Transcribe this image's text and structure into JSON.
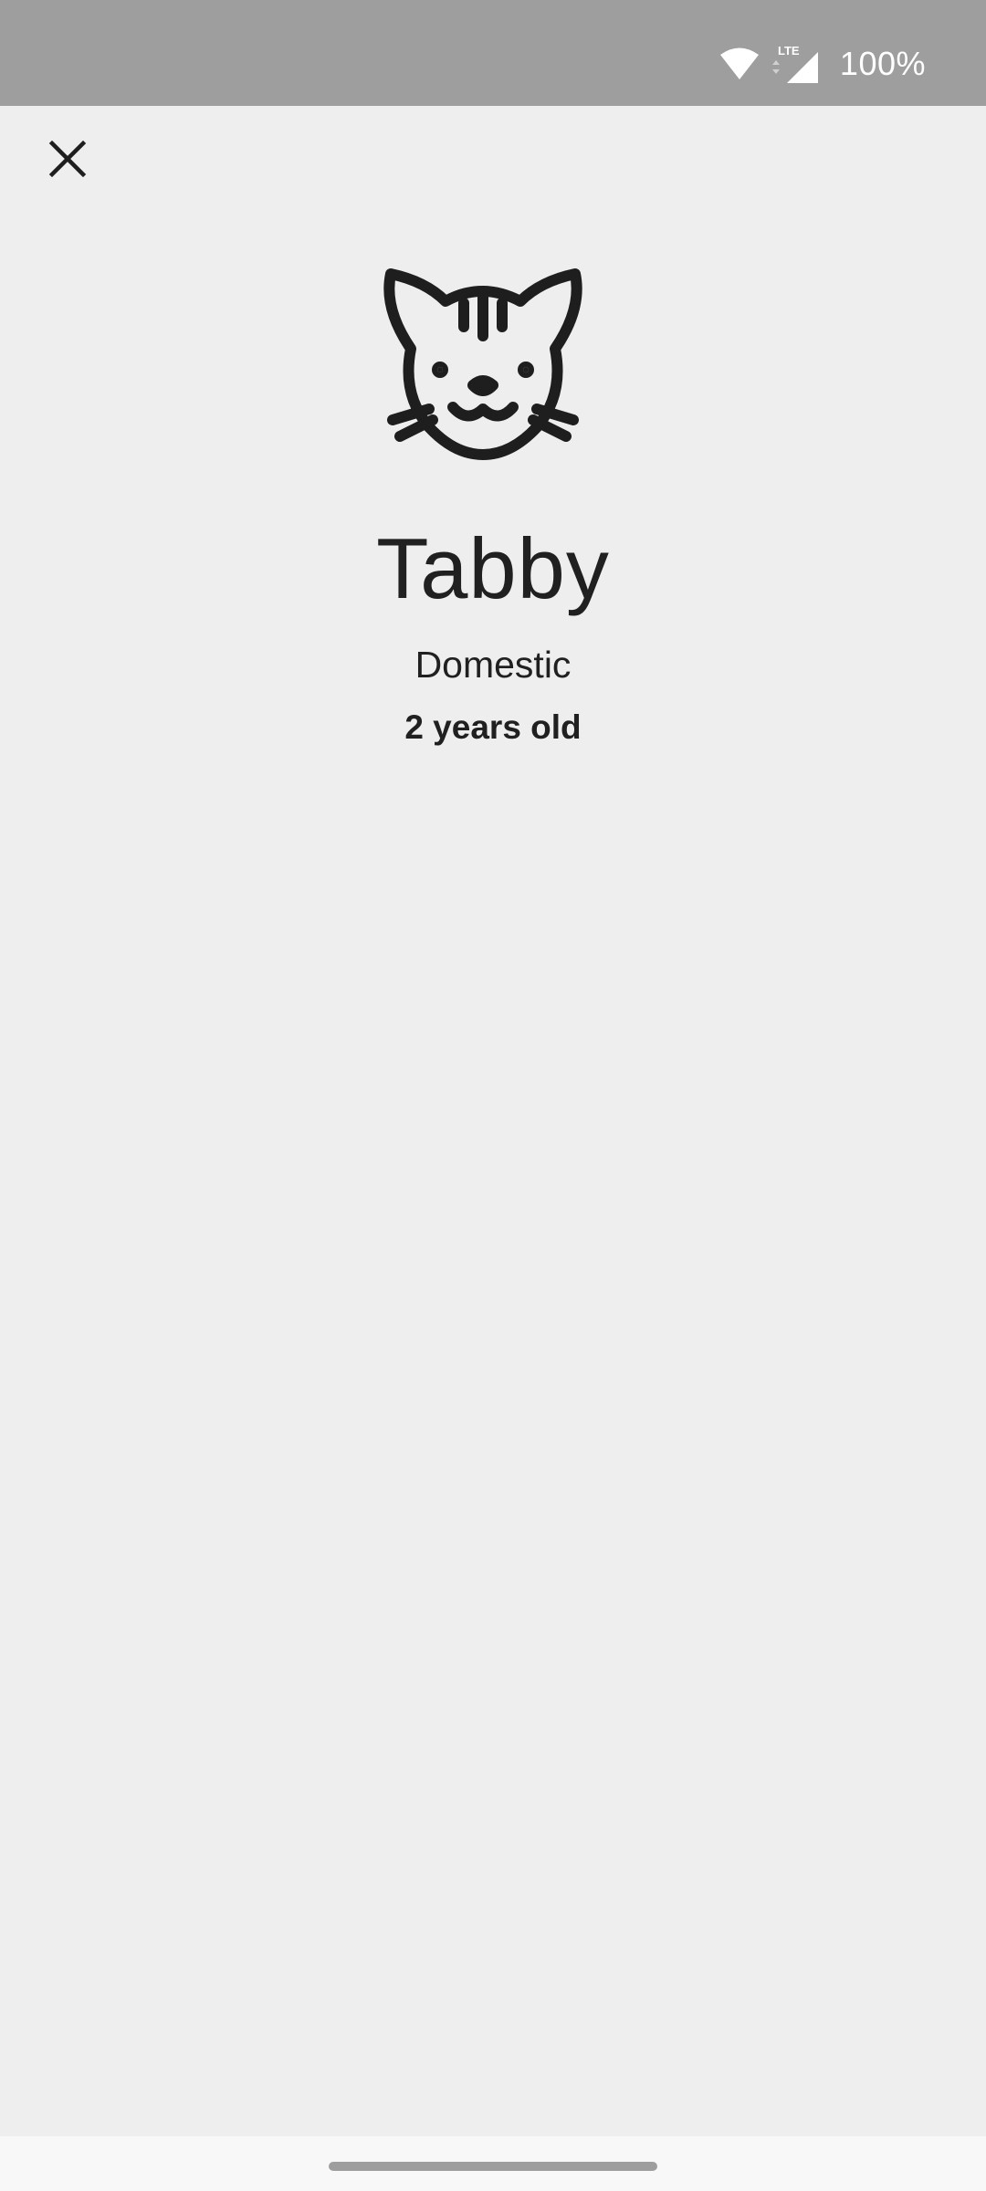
{
  "status_bar": {
    "battery": "100%",
    "network": "LTE",
    "icons": [
      "wifi-icon",
      "lte-signal-icon"
    ],
    "color": "#9e9e9e"
  },
  "toolbar": {
    "close_icon": "close-icon"
  },
  "pet": {
    "icon": "cat-face-icon",
    "name": "Tabby",
    "breed": "Domestic",
    "age": "2 years old"
  },
  "colors": {
    "background": "#eeeeee",
    "text": "#202020",
    "status_bar": "#9e9e9e",
    "nav_bar": "#f8f8f8"
  }
}
